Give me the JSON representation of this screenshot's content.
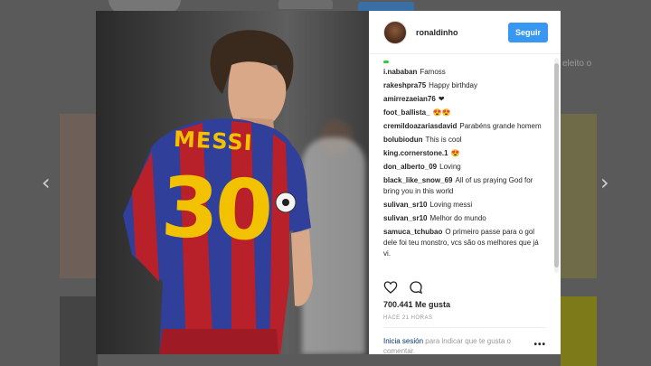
{
  "background": {
    "side_text": "eleito o"
  },
  "nav": {
    "prev_icon": "‹",
    "next_icon": "›"
  },
  "photo": {
    "jersey_name": "MESSI",
    "jersey_number": "30"
  },
  "header": {
    "username": "ronaldinho",
    "follow_label": "Seguir"
  },
  "comments": [
    {
      "user": "i.nababan",
      "text": "Famoss"
    },
    {
      "user": "rakeshpra75",
      "text": "Happy birthday"
    },
    {
      "user": "amirrezaeian76",
      "text": "❤"
    },
    {
      "user": "foot_ballista_",
      "text": "😍😍"
    },
    {
      "user": "cremildoazariasdavid",
      "text": "Parabéns grande homem"
    },
    {
      "user": "bolubiodun",
      "text": "This is cool"
    },
    {
      "user": "king.cornerstone.1",
      "text": "😍"
    },
    {
      "user": "don_alberto_09",
      "text": "Loving"
    },
    {
      "user": "black_like_snow_69",
      "text": "All of us praying God for bring you in this world"
    },
    {
      "user": "sulivan_sr10",
      "text": "Loving messi"
    },
    {
      "user": "sulivan_sr10",
      "text": "Melhor do mundo"
    },
    {
      "user": "samuca_tchubao",
      "text": "O primeiro passe para o gol dele foi teu monstro, vcs são os melhores que já vi."
    }
  ],
  "stats": {
    "likes": "700.441 Me gusta",
    "time": "HACE 21 HORAS"
  },
  "login": {
    "link": "Inicia sesión",
    "rest": " para indicar que te gusta o comentar."
  },
  "more_label": "•••",
  "colors": {
    "follow": "#3897f0",
    "link": "#003569",
    "jersey_yellow": "#f2c200"
  }
}
